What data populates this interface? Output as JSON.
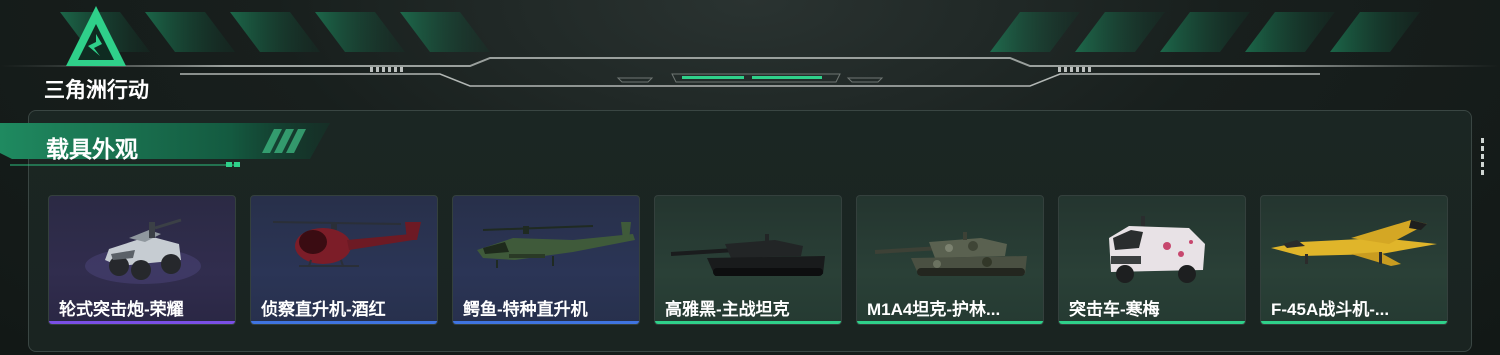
{
  "app": {
    "logo_text": "三角洲行动"
  },
  "section": {
    "title": "载具外观"
  },
  "vehicles": [
    {
      "name": "轮式突击炮-荣耀",
      "rarity_color": "#7a4fe6",
      "icon": "armored-car-icon"
    },
    {
      "name": "侦察直升机-酒红",
      "rarity_color": "#3f74e0",
      "icon": "scout-helicopter-icon"
    },
    {
      "name": "鳄鱼-特种直升机",
      "rarity_color": "#3f74e0",
      "icon": "attack-helicopter-icon"
    },
    {
      "name": "高雅黑-主战坦克",
      "rarity_color": "#2fd08a",
      "icon": "tank-icon"
    },
    {
      "name": "M1A4坦克-护林...",
      "rarity_color": "#2fd08a",
      "icon": "tank-icon"
    },
    {
      "name": "突击车-寒梅",
      "rarity_color": "#2fd08a",
      "icon": "assault-vehicle-icon"
    },
    {
      "name": "F-45A战斗机-...",
      "rarity_color": "#2fd08a",
      "icon": "fighter-jet-icon"
    }
  ],
  "colors": {
    "accent": "#2fd08a",
    "purple": "#7a4fe6",
    "blue": "#3f74e0"
  }
}
